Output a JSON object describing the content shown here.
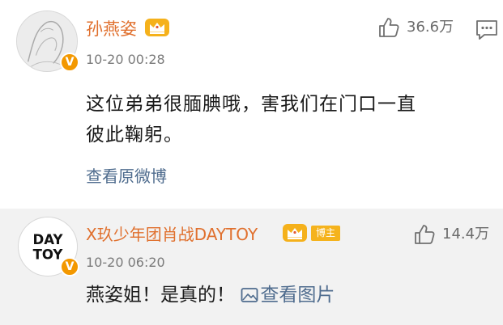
{
  "main_comment": {
    "username": "孙燕姿",
    "timestamp": "10-20 00:28",
    "content_lines": [
      "这位弟弟很腼腆哦，害我们在门口一直",
      "彼此鞠躬。"
    ],
    "view_original_label": "查看原微博",
    "like_count": "36.6万",
    "icons": {
      "avatar": "avatar-sketch",
      "verified": "verified-v-icon",
      "membership": "crown-icon",
      "like": "thumbs-up-icon",
      "comment": "comment-bubble-icon"
    }
  },
  "reply_comment": {
    "username": "X玖少年团肖战DAYTOY",
    "avatar_text_line1": "DAY",
    "avatar_text_line2": "TOY",
    "bozhu_label": "博主",
    "timestamp": "10-20 06:20",
    "content": "燕姿姐！是真的！",
    "view_image_label": "查看图片",
    "like_count": "14.4万",
    "icons": {
      "verified": "verified-v-icon",
      "membership": "crown-icon",
      "like": "thumbs-up-icon",
      "image": "image-icon"
    }
  },
  "colors": {
    "username": "#e0702e",
    "link": "#4f6c8e",
    "reply_background": "#f2f2f2",
    "verified_badge": "#f39800",
    "bozhu_badge": "#f5b31d"
  }
}
